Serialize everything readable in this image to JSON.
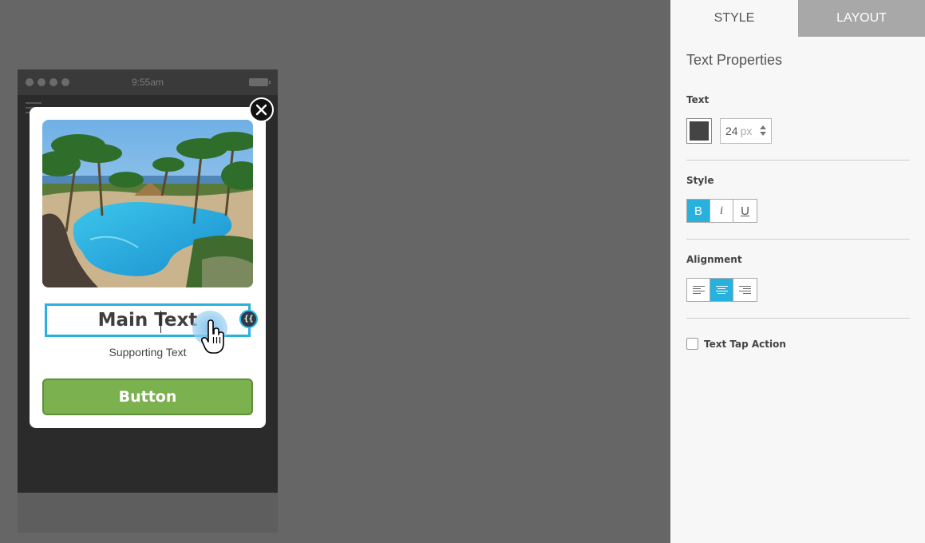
{
  "phone": {
    "time": "9:55am"
  },
  "modal": {
    "main_text": "Main Text",
    "merge_tag_label": "{{",
    "supporting_text": "Supporting Text",
    "button_label": "Button",
    "button_color": "#7cb150",
    "selection_color": "#29b1de"
  },
  "panel": {
    "tabs": [
      {
        "label": "STYLE",
        "active": true
      },
      {
        "label": "LAYOUT",
        "active": false
      }
    ],
    "title": "Text Properties",
    "text_section": {
      "label": "Text",
      "color": "#444444",
      "size_value": "24",
      "size_unit": "px"
    },
    "style_section": {
      "label": "Style",
      "buttons": [
        {
          "label": "B",
          "active": true
        },
        {
          "label": "i",
          "active": false
        },
        {
          "label": "U",
          "active": false
        }
      ]
    },
    "alignment_section": {
      "label": "Alignment",
      "options": [
        {
          "name": "left",
          "active": false,
          "icon": "align-left-icon"
        },
        {
          "name": "center",
          "active": true,
          "icon": "align-center-icon"
        },
        {
          "name": "right",
          "active": false,
          "icon": "align-right-icon"
        }
      ]
    },
    "tap_action": {
      "label": "Text Tap Action",
      "checked": false
    }
  }
}
